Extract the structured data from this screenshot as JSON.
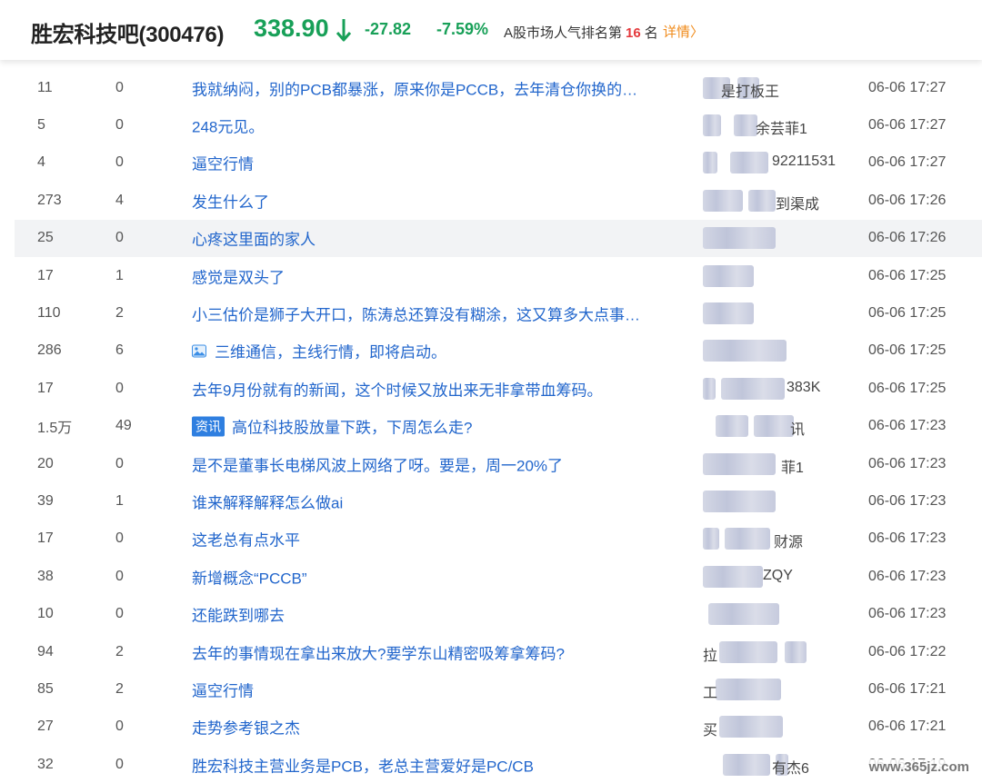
{
  "header": {
    "title": "胜宏科技吧(300476)",
    "price": "338.90",
    "change": "-27.82",
    "change_pct": "-7.59%",
    "rank_prefix": "A股市场人气排名第",
    "rank_number": "16",
    "rank_suffix": "名",
    "detail_label": "详情"
  },
  "rows": [
    {
      "read": "11",
      "reply": "0",
      "title": "我就纳闷，别的PCB都暴涨，原来你是PCCB，去年清仓你换的…",
      "author": "是打板王",
      "time": "06-06 17:27"
    },
    {
      "read": "5",
      "reply": "0",
      "title": "248元见。",
      "author": "余芸菲1",
      "time": "06-06 17:27"
    },
    {
      "read": "4",
      "reply": "0",
      "title": "逼空行情",
      "author": "92211531",
      "time": "06-06 17:27"
    },
    {
      "read": "273",
      "reply": "4",
      "title": "发生什么了",
      "author": "到渠成",
      "time": "06-06 17:26"
    },
    {
      "read": "25",
      "reply": "0",
      "title": "心疼这里面的家人",
      "author": "",
      "time": "06-06 17:26"
    },
    {
      "read": "17",
      "reply": "1",
      "title": "感觉是双头了",
      "author": "",
      "time": "06-06 17:25"
    },
    {
      "read": "110",
      "reply": "2",
      "title": "小三估价是狮子大开口，陈涛总还算没有糊涂，这又算多大点事…",
      "author": "",
      "time": "06-06 17:25"
    },
    {
      "read": "286",
      "reply": "6",
      "title": "三维通信，主线行情，即将启动。",
      "author": "",
      "time": "06-06 17:25"
    },
    {
      "read": "17",
      "reply": "0",
      "title": "去年9月份就有的新闻，这个时候又放出来无非拿带血筹码。",
      "author": "383K",
      "time": "06-06 17:25"
    },
    {
      "read": "1.5万",
      "reply": "49",
      "tag": "资讯",
      "title": "高位科技股放量下跌，下周怎么走?",
      "author": "讯",
      "time": "06-06 17:23"
    },
    {
      "read": "20",
      "reply": "0",
      "title": "是不是董事长电梯风波上网络了呀。要是，周一20%了",
      "author": "菲1",
      "time": "06-06 17:23"
    },
    {
      "read": "39",
      "reply": "1",
      "title": "谁来解释解释怎么做ai",
      "author": "",
      "time": "06-06 17:23"
    },
    {
      "read": "17",
      "reply": "0",
      "title": "这老总有点水平",
      "author": "财源",
      "time": "06-06 17:23"
    },
    {
      "read": "38",
      "reply": "0",
      "title": "新增概念“PCCB”",
      "author": "ZQY",
      "time": "06-06 17:23"
    },
    {
      "read": "10",
      "reply": "0",
      "title": "还能跌到哪去",
      "author": "",
      "time": "06-06 17:23"
    },
    {
      "read": "94",
      "reply": "2",
      "title": "去年的事情现在拿出来放大?要学东山精密吸筹拿筹码?",
      "author": "拉",
      "time": "06-06 17:22"
    },
    {
      "read": "85",
      "reply": "2",
      "title": "逼空行情",
      "author": "工",
      "time": "06-06 17:21"
    },
    {
      "read": "27",
      "reply": "0",
      "title": "走势参考银之杰",
      "author": "买",
      "time": "06-06 17:21"
    },
    {
      "read": "32",
      "reply": "0",
      "title": "胜宏科技主营业务是PCB，老总主营爱好是PC/CB",
      "author": "有杰6",
      "time": "06-06 17:19"
    }
  ],
  "watermark": "www.365jz.com",
  "colors": {
    "down": "#18a058",
    "link": "#2266cc",
    "rank": "#e4393c",
    "detail": "#f08b1b",
    "news_tag": "#2f7fe0"
  },
  "icons": {
    "price_arrow": "arrow-down-icon",
    "detail_arrow": "chevron-right-icon",
    "image": "image-icon"
  }
}
